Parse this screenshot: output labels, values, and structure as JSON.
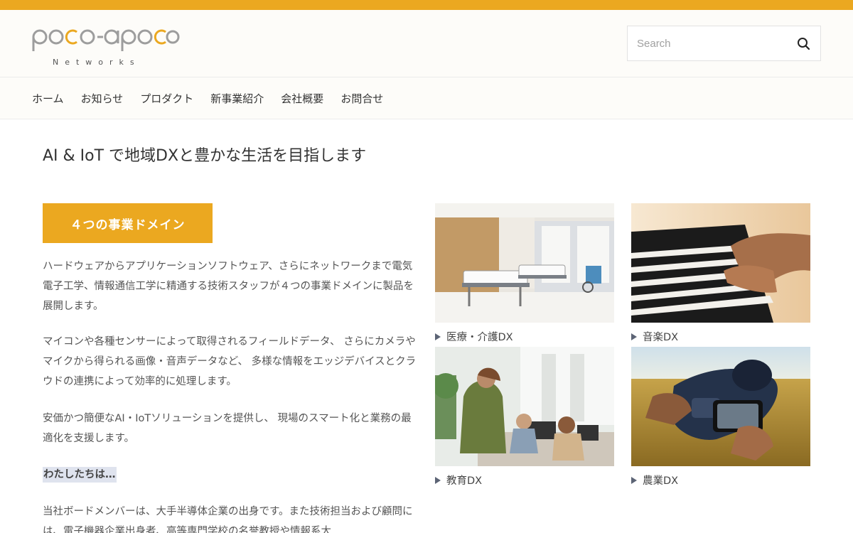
{
  "brand": {
    "accent": "#eba820",
    "logo_main": "poco-apoco",
    "logo_sub": "Networks"
  },
  "search": {
    "placeholder": "Search",
    "icon": "search-icon"
  },
  "nav": {
    "items": [
      {
        "label": "ホーム"
      },
      {
        "label": "お知らせ"
      },
      {
        "label": "プロダクト"
      },
      {
        "label": "新事業紹介"
      },
      {
        "label": "会社概要"
      },
      {
        "label": "お問合せ"
      }
    ]
  },
  "main": {
    "tagline": "AI & IoT で地域DXと豊かな生活を目指します",
    "domain_button": "４つの事業ドメイン",
    "paragraphs": [
      "ハードウェアからアプリケーションソフトウェア、さらにネットワークまで電気電子工学、情報通信工学に精通する技術スタッフが４つの事業ドメインに製品を展開します。",
      "マイコンや各種センサーによって取得されるフィールドデータ、 さらにカメラやマイクから得られる画像・音声データなど、 多様な情報をエッジデバイスとクラウドの連携によって効率的に処理します。",
      "安価かつ簡便なAI・IoTソリューションを提供し、 現場のスマート化と業務の最適化を支援します。"
    ],
    "who_heading": "わたしたちは…",
    "who_text": "当社ボードメンバーは、大手半導体企業の出身です。また技術担当および顧問には、電子機器企業出身者、高等専門学校の名誉教授や情報系大"
  },
  "domains": [
    {
      "caption": "医療・介護DX",
      "image": "hospital-room-image"
    },
    {
      "caption": "音楽DX",
      "image": "piano-hands-image"
    },
    {
      "caption": "教育DX",
      "image": "classroom-laptops-image"
    },
    {
      "caption": "農業DX",
      "image": "field-device-image"
    }
  ]
}
